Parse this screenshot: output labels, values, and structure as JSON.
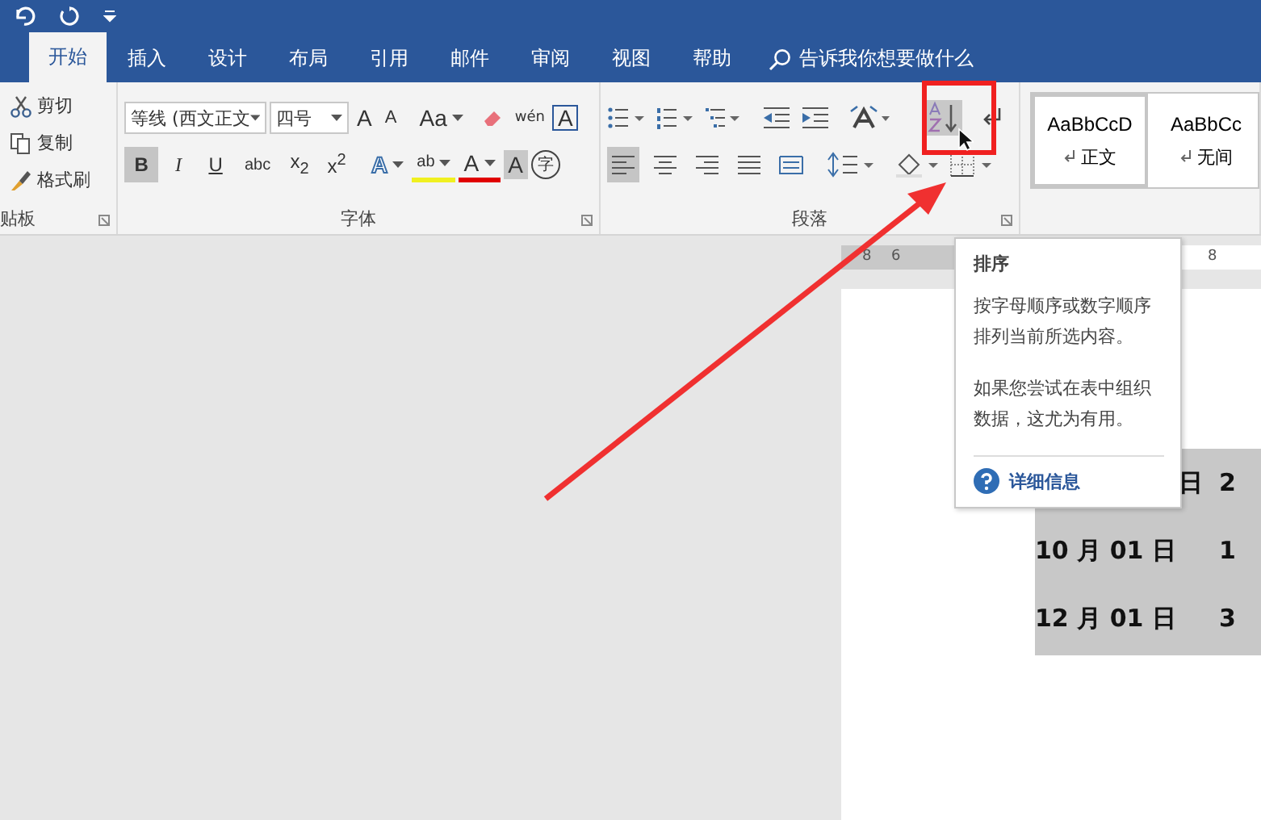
{
  "tabs": [
    {
      "label": "开始",
      "selected": true
    },
    {
      "label": "插入",
      "selected": false
    },
    {
      "label": "设计",
      "selected": false
    },
    {
      "label": "布局",
      "selected": false
    },
    {
      "label": "引用",
      "selected": false
    },
    {
      "label": "邮件",
      "selected": false
    },
    {
      "label": "审阅",
      "selected": false
    },
    {
      "label": "视图",
      "selected": false
    },
    {
      "label": "帮助",
      "selected": false
    }
  ],
  "tell_me": "告诉我你想要做什么",
  "clipboard": {
    "items": [
      {
        "kind": "cut",
        "label": "剪切"
      },
      {
        "kind": "copy",
        "label": "复制"
      },
      {
        "kind": "painter",
        "label": "格式刷"
      }
    ],
    "label": "贴板"
  },
  "font": {
    "name": "等线 (西文正文",
    "size": "四号",
    "label": "字体",
    "tools": [
      {
        "kind": "grow",
        "label": "A"
      },
      {
        "kind": "shrink",
        "label": "A"
      },
      {
        "kind": "case",
        "label": "Aa"
      },
      {
        "kind": "clear"
      },
      {
        "kind": "pinyin",
        "label": "wén"
      },
      {
        "kind": "border",
        "label": "A"
      }
    ],
    "format": [
      {
        "label": "B",
        "on": true
      },
      {
        "label": "I",
        "on": false
      },
      {
        "label": "U",
        "on": false
      },
      {
        "label": "abc",
        "on": false
      },
      {
        "label": "x$_{2}$",
        "on": false
      },
      {
        "label": "x$^{2}$",
        "on": false
      }
    ],
    "effects": [
      {
        "kind": "effect",
        "label": "A"
      },
      {
        "kind": "highlight",
        "label": "ab"
      },
      {
        "kind": "color",
        "label": "A"
      },
      {
        "kind": "shade",
        "label": "A"
      },
      {
        "kind": "enclose",
        "label": "字"
      }
    ]
  },
  "paragraph": {
    "label": "段落",
    "align": [
      {
        "kind": "left",
        "selected": true
      },
      {
        "kind": "center",
        "selected": false
      },
      {
        "kind": "right",
        "selected": false
      },
      {
        "kind": "justify",
        "selected": false
      },
      {
        "kind": "distributed",
        "selected": false
      }
    ]
  },
  "styles": [
    {
      "preview": "AaBbCcD",
      "name": "正文",
      "selected": true
    },
    {
      "preview": "AaBbCc",
      "name": "无间",
      "selected": false
    }
  ],
  "ruler": [
    "8",
    "6",
    "8"
  ],
  "tooltip": {
    "title": "排序",
    "paragraphs": [
      "按字母顺序或数字顺序排列当前所选内容。",
      "如果您尝试在表中组织数据，这尤为有用。"
    ],
    "link": "详细信息"
  },
  "table": {
    "rows": [
      [
        "日",
        "2"
      ],
      [
        "10 月 01 日",
        "1"
      ],
      [
        "12 月 01 日",
        "3"
      ]
    ]
  }
}
